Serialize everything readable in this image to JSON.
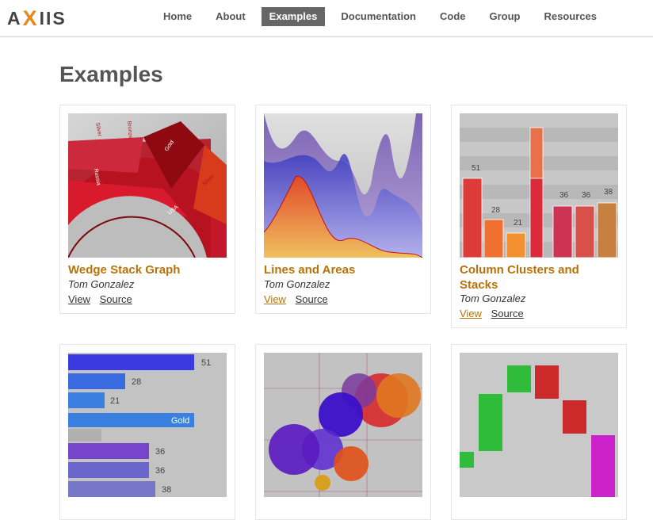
{
  "logo": {
    "text_a": "A",
    "text_x": "X",
    "text_rest": "IIS"
  },
  "nav": [
    "Home",
    "About",
    "Examples",
    "Documentation",
    "Code",
    "Group",
    "Resources"
  ],
  "page_title": "Examples",
  "cards": [
    {
      "title": "Wedge Stack Graph",
      "author": "Tom Gonzalez",
      "view": "View",
      "source": "Source"
    },
    {
      "title": "Lines and Areas",
      "author": "Tom Gonzalez",
      "view": "View",
      "source": "Source"
    },
    {
      "title": "Column Clusters and Stacks",
      "author": "Tom Gonzalez",
      "view": "View",
      "source": "Source"
    }
  ],
  "thumbs": {
    "wedge_labels": [
      "Silver",
      "Bronze",
      "Gold",
      "Silver",
      "Russia",
      "USA"
    ],
    "column_labels": [
      "51",
      "28",
      "21",
      "36",
      "36",
      "38"
    ],
    "bar_labels": [
      "51",
      "28",
      "21",
      "Gold",
      "36",
      "36",
      "38"
    ]
  },
  "colors": {
    "accent": "#b8720a",
    "nav_active": "#666666"
  }
}
